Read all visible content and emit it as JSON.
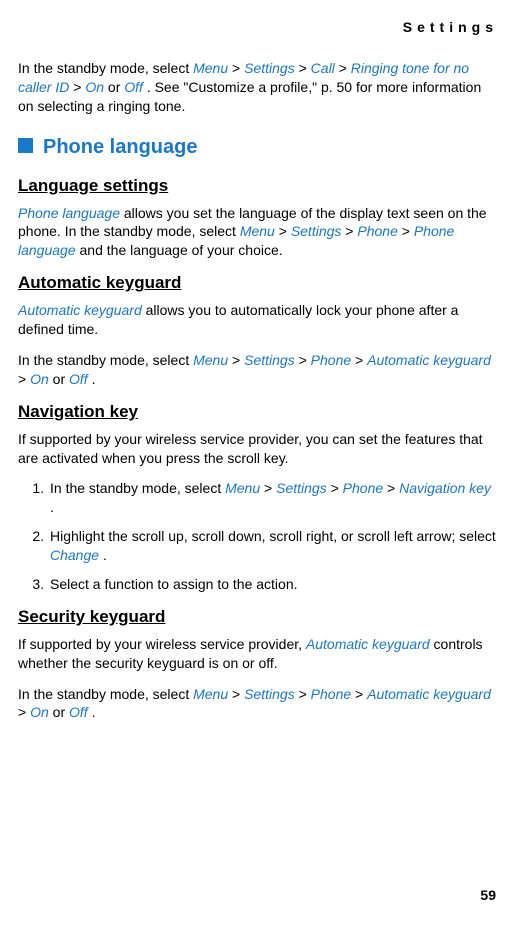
{
  "header": {
    "running_title": "Settings"
  },
  "intro": {
    "pre": "In the standby mode, select ",
    "menu": "Menu",
    "sep": " > ",
    "settings": "Settings",
    "call": "Call",
    "ringing": "Ringing tone for no caller ID",
    "on": "On",
    "or": " or ",
    "off": "Off",
    "post": ". See \"Customize a profile,\" p. 50 for more information on selecting a ringing tone."
  },
  "section": {
    "title": "Phone language"
  },
  "lang": {
    "heading": "Language settings",
    "term": "Phone language",
    "desc1": " allows you set the language of the display text seen on the phone. In the standby mode, select ",
    "menu": "Menu",
    "sep": " > ",
    "settings": "Settings",
    "phone": "Phone",
    "phoneLang": "Phone language",
    "desc2": " and the language of your choice."
  },
  "autokey": {
    "heading": "Automatic keyguard",
    "term": "Automatic keyguard",
    "desc": " allows you to automatically lock your phone after a defined time.",
    "pre": "In the standby mode, select ",
    "menu": "Menu",
    "sep": " > ",
    "settings": "Settings",
    "phone": "Phone",
    "autokey": "Automatic keyguard",
    "on": "On",
    "or": " or ",
    "off": "Off",
    "period": "."
  },
  "nav": {
    "heading": "Navigation key",
    "intro": "If supported by your wireless service provider, you can set the features that are activated when you press the scroll key.",
    "step1_pre": "In the standby mode, select ",
    "menu": "Menu",
    "sep": " > ",
    "settings": "Settings",
    "phone": "Phone",
    "navkey": "Navigation key",
    "period": ".",
    "step2_pre": "Highlight the scroll up, scroll down, scroll right, or scroll left arrow; select ",
    "change": "Change",
    "step3": "Select a function to assign to the action."
  },
  "security": {
    "heading": "Security keyguard",
    "intro_pre": "If supported by your wireless service provider, ",
    "term": "Automatic keyguard",
    "intro_post": " controls whether the security keyguard is on or off.",
    "pre": "In the standby mode, select ",
    "menu": "Menu",
    "sep": " > ",
    "settings": "Settings",
    "phone": "Phone",
    "autokey": "Automatic keyguard",
    "on": "On",
    "or": " or ",
    "off": "Off",
    "period": "."
  },
  "footer": {
    "page_number": "59"
  }
}
